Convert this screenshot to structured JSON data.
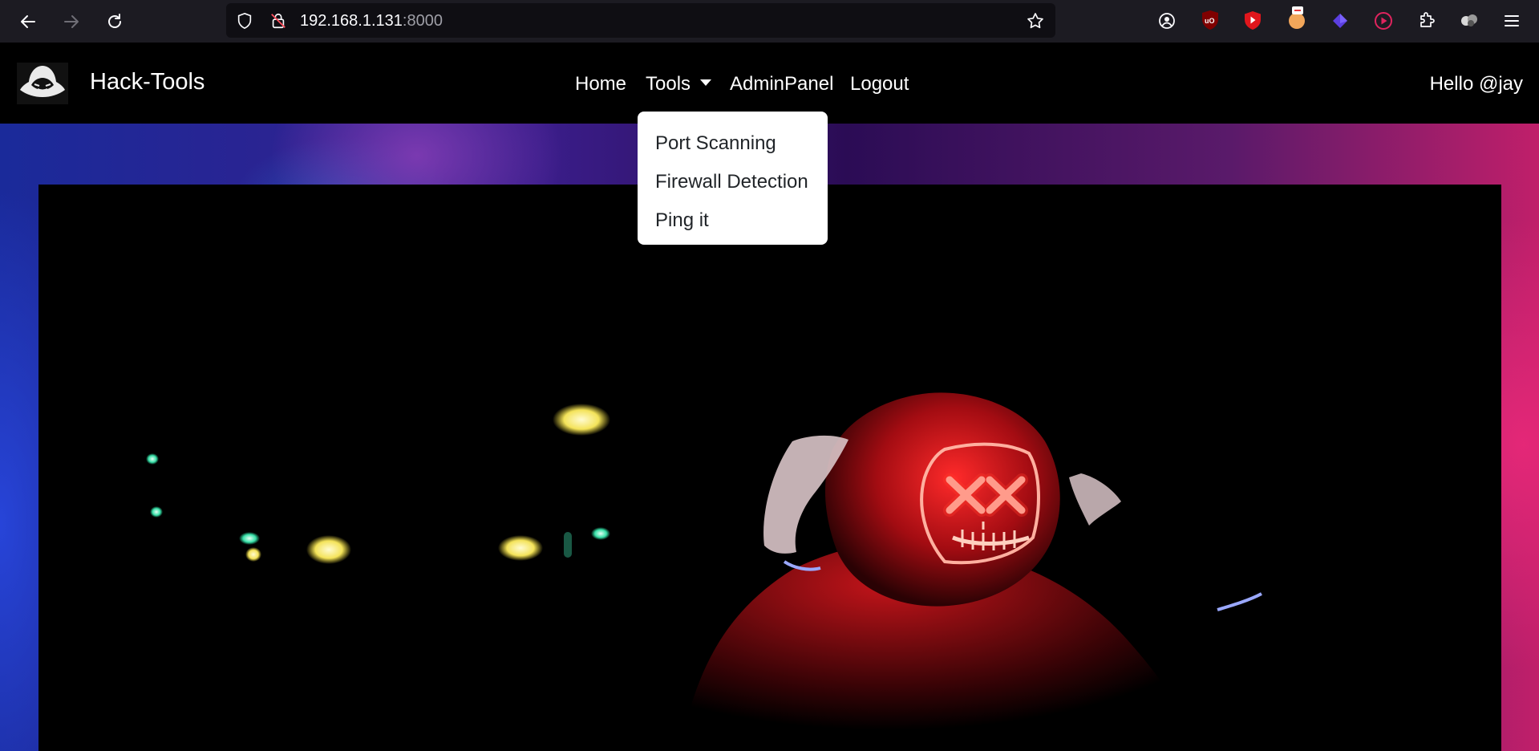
{
  "browser": {
    "url_host": "192.168.1.131",
    "url_port": ":8000",
    "icons": [
      "back-icon",
      "forward-icon",
      "reload-icon",
      "shield-icon",
      "insecure-lock-icon",
      "bookmark-star-icon",
      "account-icon",
      "ublock-icon",
      "youtube-icon",
      "extension-icon",
      "extension-icon",
      "extension-icon",
      "extensions-puzzle-icon",
      "profile-icon",
      "menu-icon"
    ]
  },
  "site": {
    "brand": "Hack-Tools",
    "nav": {
      "home": "Home",
      "tools": "Tools",
      "admin": "AdminPanel",
      "logout": "Logout"
    },
    "greeting": "Hello @jay",
    "tools_menu": [
      "Port Scanning",
      "Firewall Detection",
      "Ping it"
    ]
  },
  "colors": {
    "nav_bg": "#000000",
    "dropdown_bg": "#ffffff",
    "mask_glow": "#ff2a2a"
  }
}
